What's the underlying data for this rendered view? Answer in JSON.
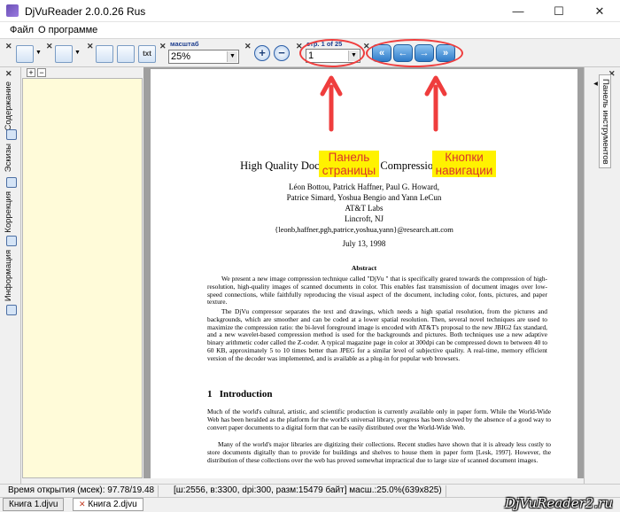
{
  "window": {
    "title": "DjVuReader 2.0.0.26 Rus",
    "minimize": "—",
    "maximize": "☐",
    "close": "✕"
  },
  "menu": [
    "Файл",
    "О программе"
  ],
  "toolbar": {
    "zoom_label": "масштаб",
    "zoom_value": "25%",
    "page_label": "стр. 1 of 25",
    "page_value": "1",
    "zoom_in": "+",
    "zoom_out": "−",
    "nav": {
      "first": "«",
      "prev": "←",
      "next": "→",
      "last": "»"
    },
    "txt": "txt"
  },
  "sidebar": {
    "tabs": [
      "Содержание",
      "Эскизы",
      "Коррекция",
      "Информация"
    ],
    "expand": "+",
    "collapse": "−"
  },
  "right_panel": {
    "label": "Панель инструментов ◂"
  },
  "document": {
    "title": "High Quality Document Image Compression with DjVu",
    "authors_line1": "Léon Bottou, Patrick Haffner, Paul G. Howard,",
    "authors_line2": "Patrice Simard, Yoshua Bengio and Yann LeCun",
    "affil": "AT&T Labs",
    "location": "Lincroft, NJ",
    "email": "{leonb,haffner,pgh,patrice,yoshua,yann}@research.att.com",
    "date": "July 13, 1998",
    "abstract_title": "Abstract",
    "abstract_p1": "We present a new image compression technique called \"DjVu \" that is specifically geared towards the compression of high-resolution, high-quality images of scanned documents in color. This enables fast transmission of document images over low-speed connections, while faithfully reproducing the visual aspect of the document, including color, fonts, pictures, and paper texture.",
    "abstract_p2": "The DjVu compressor separates the text and drawings, which needs a high spatial resolution, from the pictures and backgrounds, which are smoother and can be coded at a lower spatial resolution. Then, several novel techniques are used to maximize the compression ratio: the bi-level foreground image is encoded with AT&T's proposal to the new JBIG2 fax standard, and a new wavelet-based compression method is used for the backgrounds and pictures. Both techniques use a new adaptive binary arithmetic coder called the Z-coder. A typical magazine page in color at 300dpi can be compressed down to between 40 to 60 KB, approximately 5 to 10 times better than JPEG for a similar level of subjective quality. A real-time, memory efficient version of the decoder was implemented, and is available as a plug-in for popular web browsers.",
    "section_title": "1   Introduction",
    "intro_p1": "Much of the world's cultural, artistic, and scientific production is currently available only in paper form. While the World-Wide Web has been heralded as the platform for the world's universal library, progress has been slowed by the absence of a good way to convert paper documents to a digital form that can be easily distributed over the World-Wide Web.",
    "intro_p2": "Many of the world's major libraries are digitizing their collections. Recent studies have shown that it is already less costly to store documents digitally than to provide for buildings and shelves to house them in paper form [Lesk, 1997]. However, the distribution of these collections over the web has proved somewhat impractical due to large size of scanned document images."
  },
  "annotations": {
    "panel_label": "Панель страницы",
    "nav_label": "Кнопки навигации",
    "color": "#ef3d3d",
    "label_bg": "#fff200"
  },
  "status": {
    "open_time": "Время открытия (мсек): 97.78/19.48",
    "info": "[ш:2556, в:3300, dpi:300, разм:15479 байт] масш.:25.0%(639x825)"
  },
  "doc_tabs": [
    "Книга 1.djvu",
    "Книга 2.djvu"
  ],
  "watermark": "DjVuReader2.ru"
}
